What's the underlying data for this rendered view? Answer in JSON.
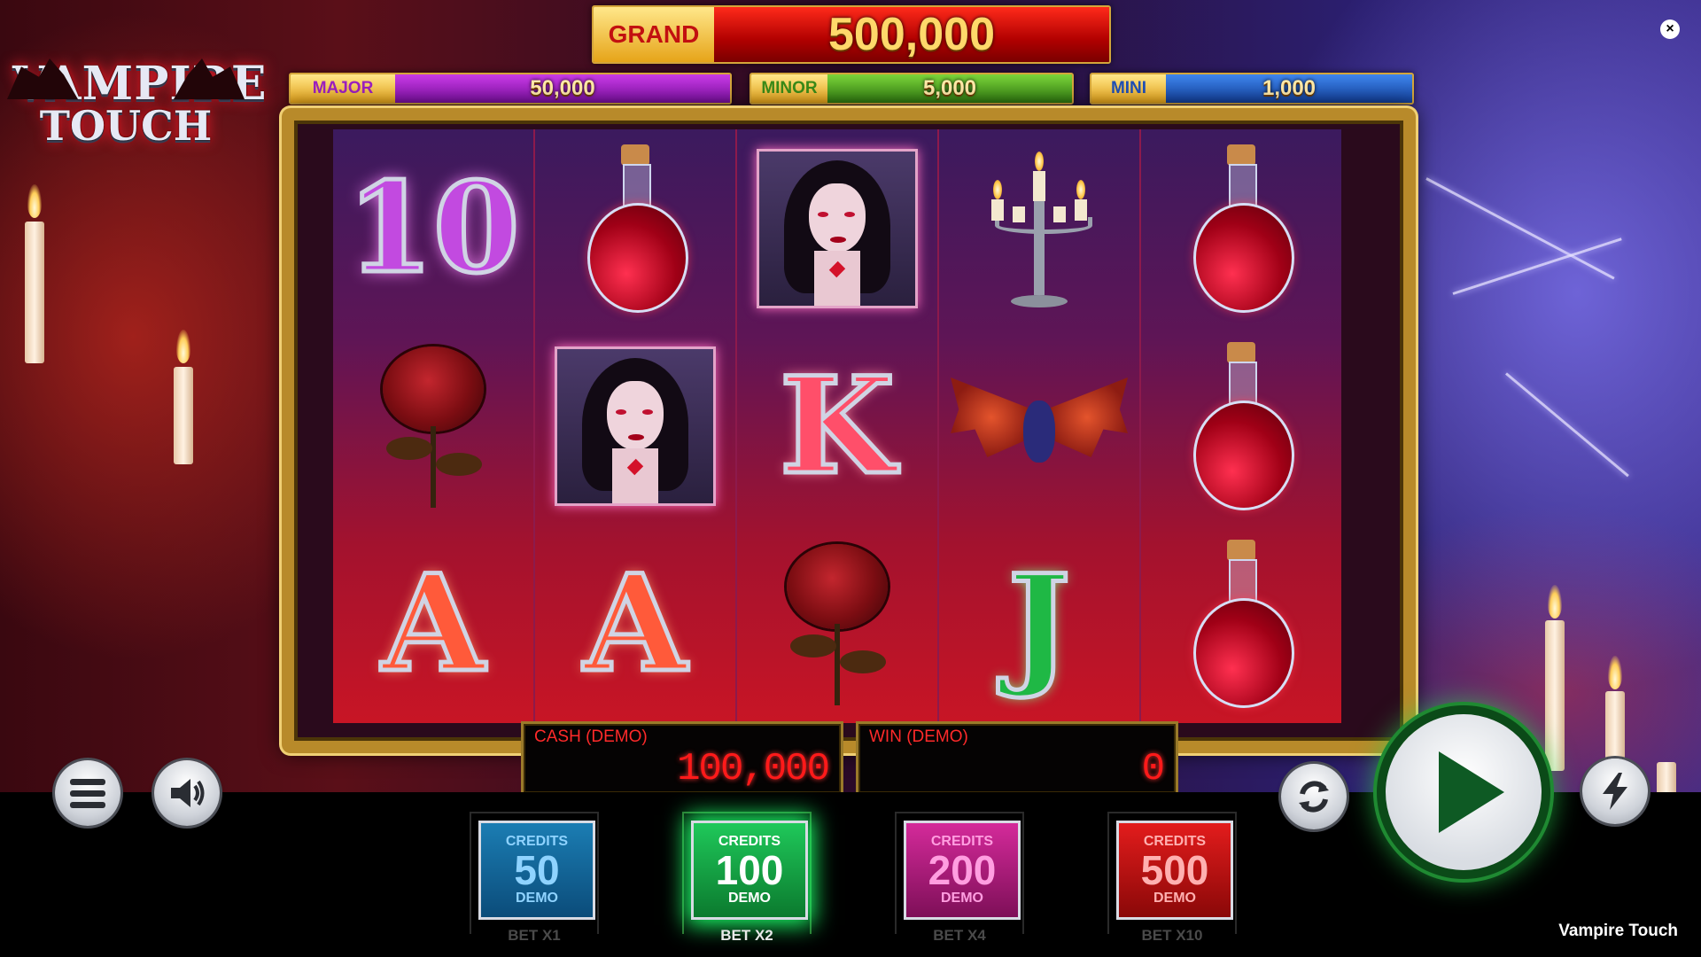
{
  "game": {
    "title": "Vampire Touch",
    "logo_line1": "VAMPIRE",
    "logo_line2": "TOUCH"
  },
  "jackpots": {
    "grand": {
      "label": "GRAND",
      "value": "500,000"
    },
    "major": {
      "label": "MAJOR",
      "value": "50,000"
    },
    "minor": {
      "label": "MINOR",
      "value": "5,000"
    },
    "mini": {
      "label": "MINI",
      "value": "1,000"
    }
  },
  "reels": [
    [
      "ten",
      "rose",
      "ace-red"
    ],
    [
      "blood-potion",
      "vampire-lady",
      "ace-red"
    ],
    [
      "vampire-lady",
      "king",
      "rose"
    ],
    [
      "candelabra",
      "bat",
      "jack-green"
    ],
    [
      "blood-potion",
      "blood-potion",
      "blood-potion"
    ]
  ],
  "symbols": {
    "ten": "10",
    "king": "K",
    "ace": "A",
    "jack": "J"
  },
  "cash": {
    "label": "CASH (DEMO)",
    "value": "100,000"
  },
  "win": {
    "label": "WIN (DEMO)",
    "value": "0"
  },
  "bets": [
    {
      "top": "CREDITS",
      "amount": "50",
      "bottom": "DEMO",
      "label": "BET X1",
      "color": "#1b7db3",
      "selected": false
    },
    {
      "top": "CREDITS",
      "amount": "100",
      "bottom": "DEMO",
      "label": "BET X2",
      "color": "#1fc85a",
      "selected": true
    },
    {
      "top": "CREDITS",
      "amount": "200",
      "bottom": "DEMO",
      "label": "BET X4",
      "color": "#d42a9a",
      "selected": false
    },
    {
      "top": "CREDITS",
      "amount": "500",
      "bottom": "DEMO",
      "label": "BET X10",
      "color": "#e31c1c",
      "selected": false
    }
  ],
  "controls": {
    "menu_icon": "hamburger-icon",
    "sound_icon": "speaker-icon",
    "autoplay_icon": "refresh-icon",
    "spin_icon": "play-icon",
    "turbo_icon": "lightning-icon",
    "close_icon": "close-icon",
    "close_glyph": "×"
  }
}
